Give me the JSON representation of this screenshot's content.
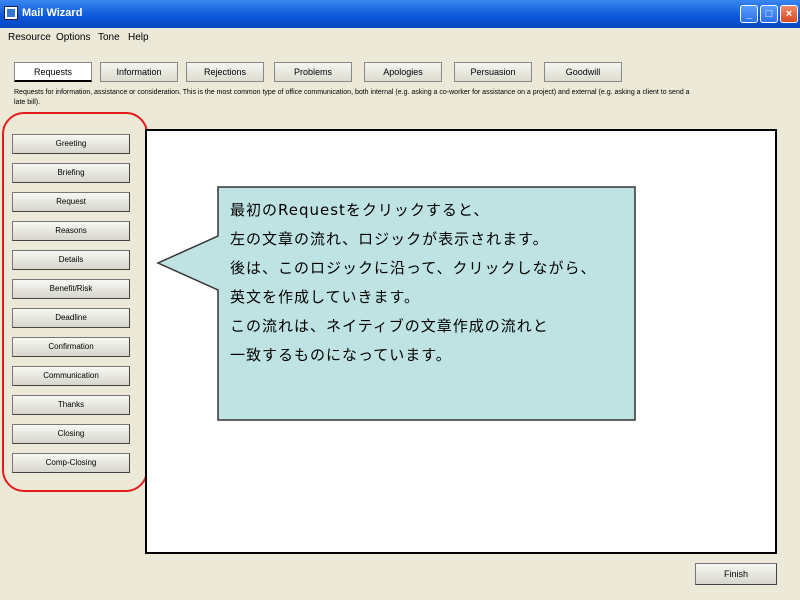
{
  "window": {
    "title": "Mail Wizard"
  },
  "menu": [
    "Resource",
    "Options",
    "Tone",
    "Help"
  ],
  "tabs": [
    "Requests",
    "Information",
    "Rejections",
    "Problems",
    "Apologies",
    "Persuasion",
    "Goodwill"
  ],
  "description": "Requests for information, assistance or consideration.  This is the most common type of office communication, both internal (e.g. asking a co-worker for assistance on a project) and external (e.g. asking a client to send a late bill).",
  "left_buttons": [
    "Greeting",
    "Briefing",
    "Request",
    "Reasons",
    "Details",
    "Benefit/Risk",
    "Deadline",
    "Confirmation",
    "Communication",
    "Thanks",
    "Closing",
    "Comp-Closing"
  ],
  "callout_lines": [
    "最初のRequestをクリックすると、",
    "左の文章の流れ、ロジックが表示されます。",
    "後は、このロジックに沿って、クリックしながら、",
    "英文を作成していきます。",
    "この流れは、ネイティブの文章作成の流れと",
    "一致するものになっています。"
  ],
  "finish_label": "Finish",
  "colors": {
    "titlebar": "#0a56d8",
    "callout_fill": "#bfe3e3",
    "highlight": "#e21c1c"
  }
}
